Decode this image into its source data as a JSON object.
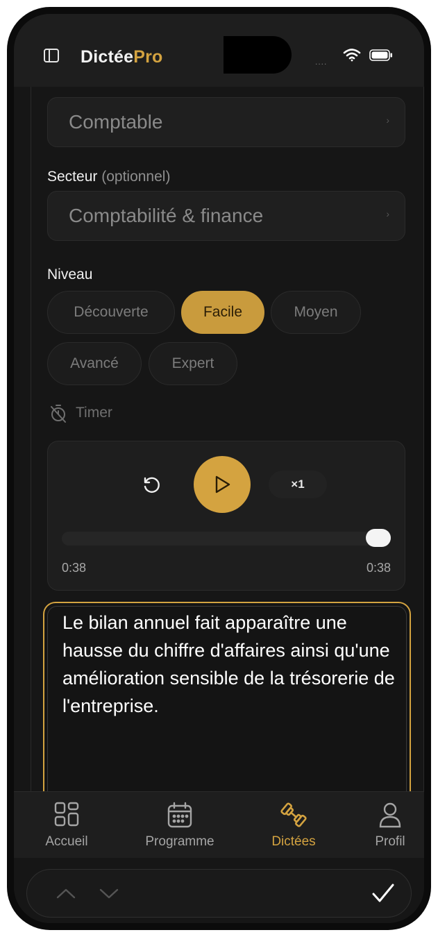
{
  "app": {
    "title_main": "Dictée",
    "title_accent": "Pro",
    "accent_color": "#d4a340",
    "status": {
      "signal": "....",
      "wifi_icon": "wifi-icon",
      "battery_icon": "battery-icon"
    }
  },
  "form": {
    "job_select": {
      "value": "Comptable",
      "chevron": "›"
    },
    "sector_label": "Secteur",
    "sector_optional": "(optionnel)",
    "sector_select": {
      "value": "Comptabilité & finance",
      "chevron": "›"
    },
    "level_label": "Niveau",
    "levels": [
      {
        "label": "Découverte",
        "selected": false
      },
      {
        "label": "Facile",
        "selected": true
      },
      {
        "label": "Moyen",
        "selected": false
      },
      {
        "label": "Avancé",
        "selected": false
      },
      {
        "label": "Expert",
        "selected": false
      }
    ],
    "timer_label": "Timer"
  },
  "player": {
    "speed": "×1",
    "elapsed": "0:38",
    "duration": "0:38",
    "progress": 1.0
  },
  "editor": {
    "text": "Le bilan annuel fait apparaître une hausse du chiffre d'affaires ainsi qu'une amélioration sensible de la trésorerie de l'entreprise."
  },
  "tabs": [
    {
      "label": "Accueil",
      "icon": "grid-icon",
      "active": false
    },
    {
      "label": "Programme",
      "icon": "calendar-icon",
      "active": false
    },
    {
      "label": "Dictées",
      "icon": "dumbbell-icon",
      "active": true
    },
    {
      "label": "Profil",
      "icon": "user-icon",
      "active": false
    }
  ]
}
